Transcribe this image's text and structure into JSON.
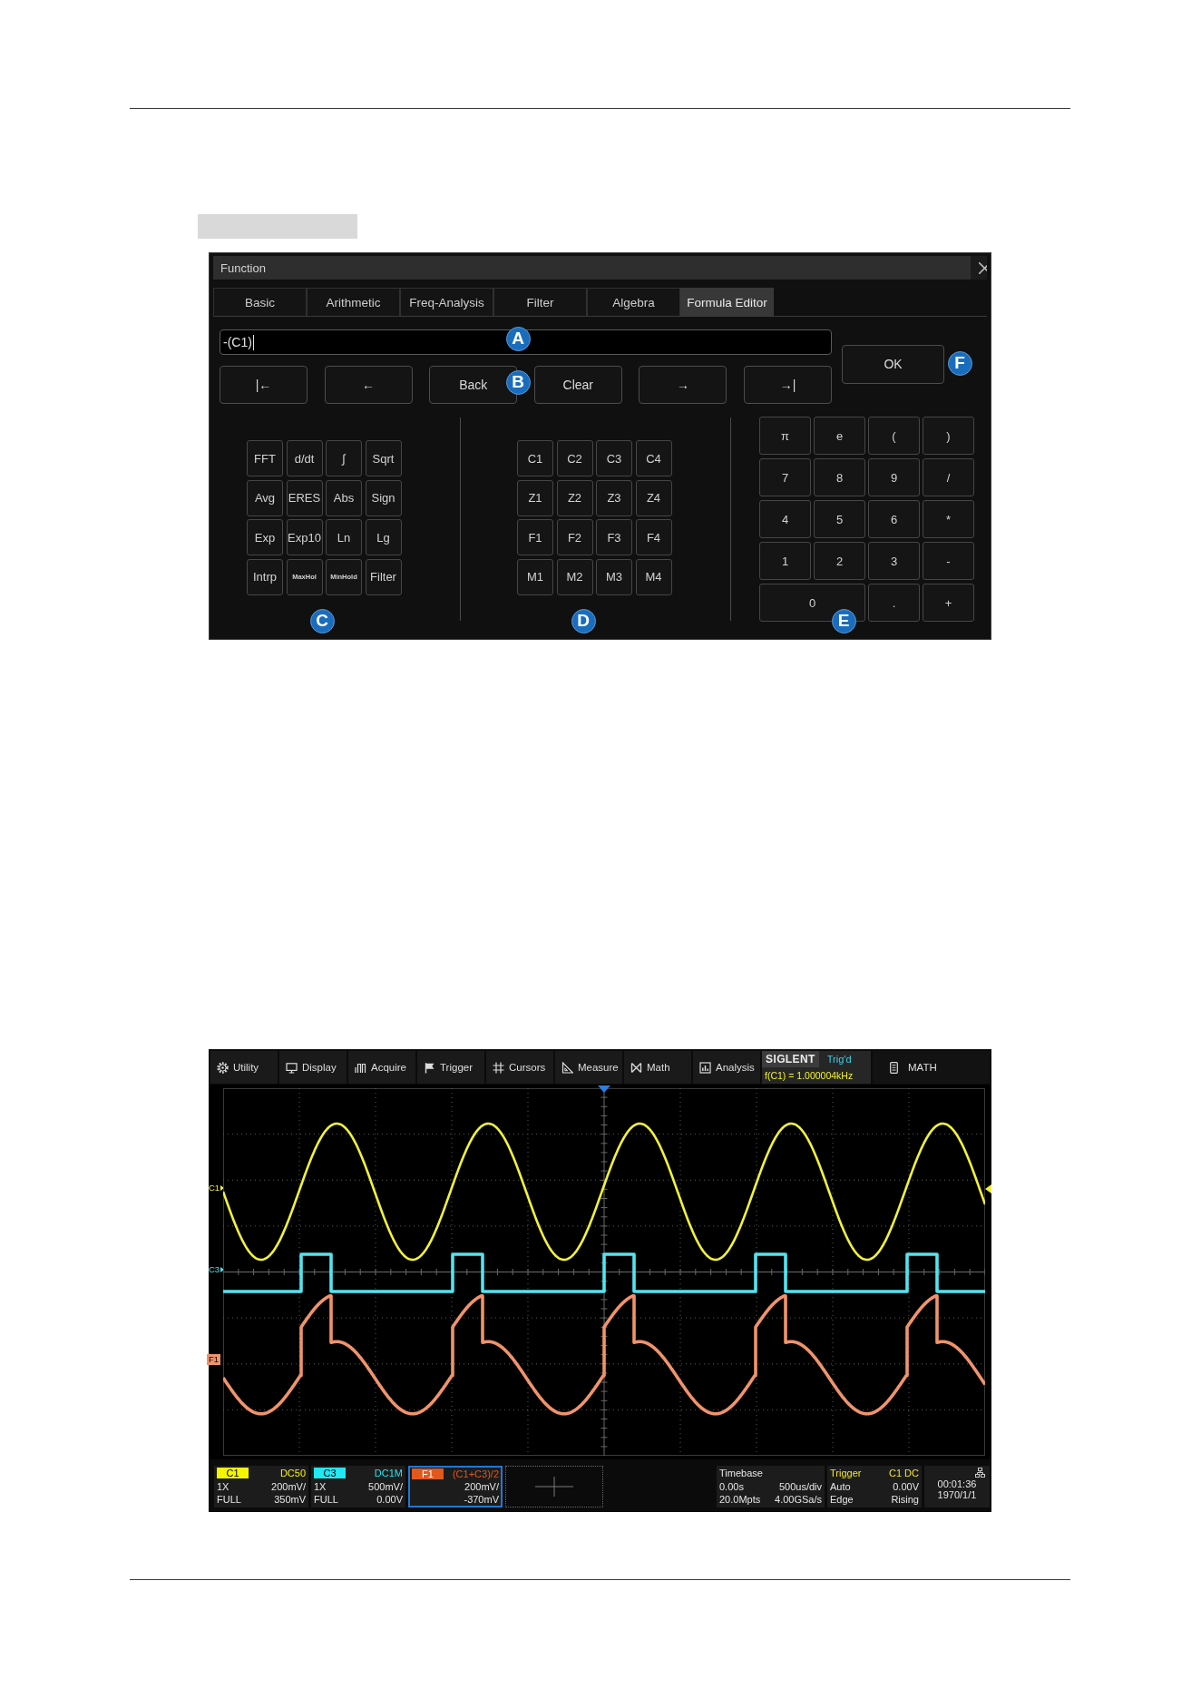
{
  "dialog": {
    "title": "Function",
    "tabs": [
      {
        "label": "Basic",
        "selected": false
      },
      {
        "label": "Arithmetic",
        "selected": false
      },
      {
        "label": "Freq-Analysis",
        "selected": false
      },
      {
        "label": "Filter",
        "selected": false
      },
      {
        "label": "Algebra",
        "selected": false
      },
      {
        "label": "Formula Editor",
        "selected": true
      }
    ],
    "formula_field": {
      "value": "-(C1)"
    },
    "edit_buttons": [
      "|←",
      "←",
      "Back",
      "Clear",
      "→",
      "→|"
    ],
    "ok_button": "OK",
    "function_keys": [
      {
        "label": "FFT",
        "kind": "key"
      },
      {
        "label": "d/dt",
        "kind": "key"
      },
      {
        "label": "∫",
        "kind": "key"
      },
      {
        "label": "Sqrt",
        "kind": "key"
      },
      {
        "label": "Avg",
        "kind": "key"
      },
      {
        "label": "ERES",
        "kind": "key"
      },
      {
        "label": "Abs",
        "kind": "key"
      },
      {
        "label": "Sign",
        "kind": "key"
      },
      {
        "label": "Exp",
        "kind": "key"
      },
      {
        "label": "Exp10",
        "kind": "key"
      },
      {
        "label": "Ln",
        "kind": "key"
      },
      {
        "label": "Lg",
        "kind": "key"
      },
      {
        "label": "Intrp",
        "kind": "key"
      },
      {
        "label": "MaxHol",
        "kind": "small"
      },
      {
        "label": "MinHold",
        "kind": "small"
      },
      {
        "label": "Filter",
        "kind": "key"
      }
    ],
    "source_keys": [
      "C1",
      "C2",
      "C3",
      "C4",
      "Z1",
      "Z2",
      "Z3",
      "Z4",
      "F1",
      "F2",
      "F3",
      "F4",
      "M1",
      "M2",
      "M3",
      "M4"
    ],
    "number_keys": [
      {
        "label": "π",
        "kind": "key"
      },
      {
        "label": "e",
        "kind": "key"
      },
      {
        "label": "(",
        "kind": "key"
      },
      {
        "label": ")",
        "kind": "key"
      },
      {
        "label": "7",
        "kind": "key"
      },
      {
        "label": "8",
        "kind": "key"
      },
      {
        "label": "9",
        "kind": "key"
      },
      {
        "label": "/",
        "kind": "key"
      },
      {
        "label": "4",
        "kind": "key"
      },
      {
        "label": "5",
        "kind": "key"
      },
      {
        "label": "6",
        "kind": "key"
      },
      {
        "label": "*",
        "kind": "key"
      },
      {
        "label": "1",
        "kind": "key"
      },
      {
        "label": "2",
        "kind": "key"
      },
      {
        "label": "3",
        "kind": "key"
      },
      {
        "label": "-",
        "kind": "key"
      },
      {
        "label": "0",
        "kind": "wide"
      },
      {
        "label": ".",
        "kind": "key"
      },
      {
        "label": "+",
        "kind": "key"
      }
    ],
    "callouts": [
      "A",
      "B",
      "C",
      "D",
      "E",
      "F"
    ]
  },
  "scope": {
    "menu": [
      "Utility",
      "Display",
      "Acquire",
      "Trigger",
      "Cursors",
      "Measure",
      "Math",
      "Analysis"
    ],
    "brand": "SIGLENT",
    "trigger_status": "Trig'd",
    "measurement": "f(C1) = 1.000004kHz",
    "mode": "MATH",
    "traces": [
      {
        "label": "C1",
        "kind": "sine",
        "color": "#f2f23a"
      },
      {
        "label": "C3",
        "kind": "pulse",
        "color": "#52e4f0"
      },
      {
        "label": "F1",
        "kind": "math",
        "color": "#f0936b"
      }
    ],
    "channels": [
      {
        "label": "C1",
        "color": "#f5f500",
        "selected": false,
        "coupling": "DC50",
        "probe": "1X",
        "scale": "200mV/",
        "bandwidth": "FULL",
        "offset": "350mV"
      },
      {
        "label": "C3",
        "color": "#22e8f2",
        "selected": false,
        "coupling": "DC1M",
        "probe": "1X",
        "scale": "500mV/",
        "bandwidth": "FULL",
        "offset": "0.00V"
      },
      {
        "label": "F1",
        "color": "#e2581c",
        "selected": true,
        "formula": "(C1+C3)/2",
        "scale": "200mV/",
        "offset": "-370mV"
      }
    ],
    "timebase": {
      "title": "Timebase",
      "delay": "0.00s",
      "scale": "500us/div",
      "memory_depth": "20.0Mpts",
      "sample_rate": "4.00GSa/s"
    },
    "trigger": {
      "title": "Trigger",
      "source": "C1 DC",
      "mode": "Auto",
      "threshold": "0.00V",
      "type": "Edge",
      "slope": "Rising"
    },
    "clock": {
      "time": "00:01:36",
      "date": "1970/1/1"
    }
  }
}
